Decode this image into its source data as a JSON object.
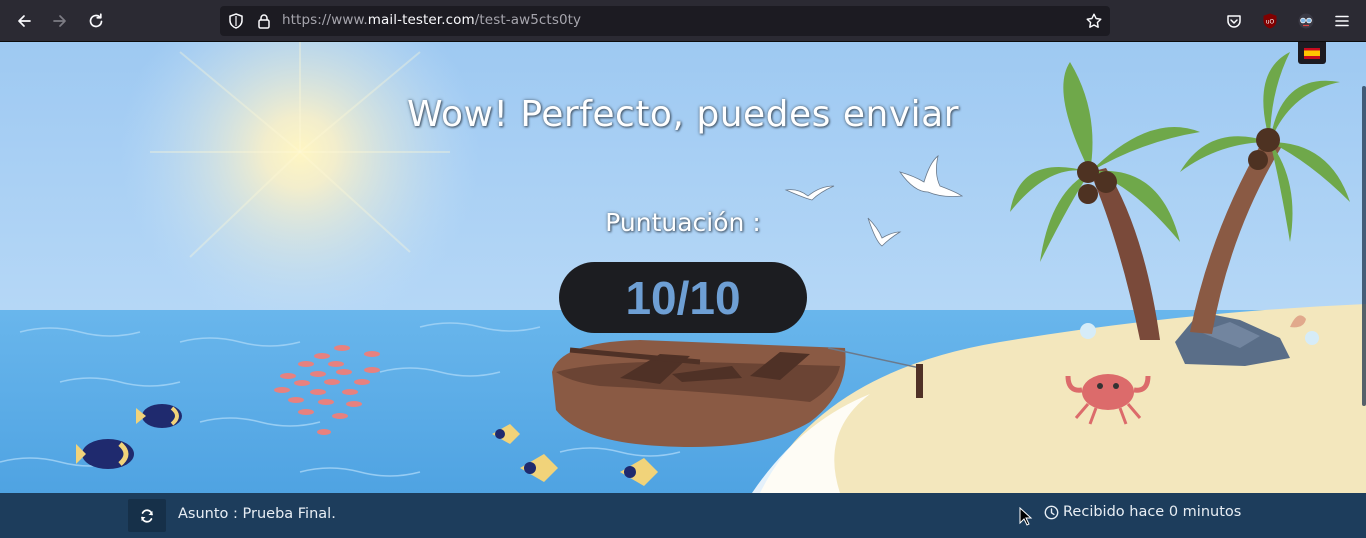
{
  "browser": {
    "url_prefix": "https://www.",
    "url_host": "mail-tester.com",
    "url_path": "/test-aw5cts0ty",
    "icons": [
      "back-arrow-icon",
      "forward-arrow-icon",
      "reload-icon",
      "shield-icon",
      "lock-icon",
      "star-icon",
      "pocket-icon",
      "ublock-icon",
      "extension-icon",
      "menu-icon"
    ]
  },
  "page": {
    "headline": "Wow! Perfecto, puedes enviar",
    "score_label": "Puntuación :",
    "score": "10/10",
    "language_flag": "es",
    "colors": {
      "score": "#6e9fd4",
      "footer": "#1d3d5c",
      "sky": "#a9d2f5",
      "sea": "#5eaee8",
      "sand": "#f3e7bd"
    }
  },
  "footer": {
    "subject": "Asunto : Prueba Final.",
    "received": "Recibido hace 0 minutos",
    "icons": [
      "refresh-icon",
      "clock-icon"
    ]
  }
}
